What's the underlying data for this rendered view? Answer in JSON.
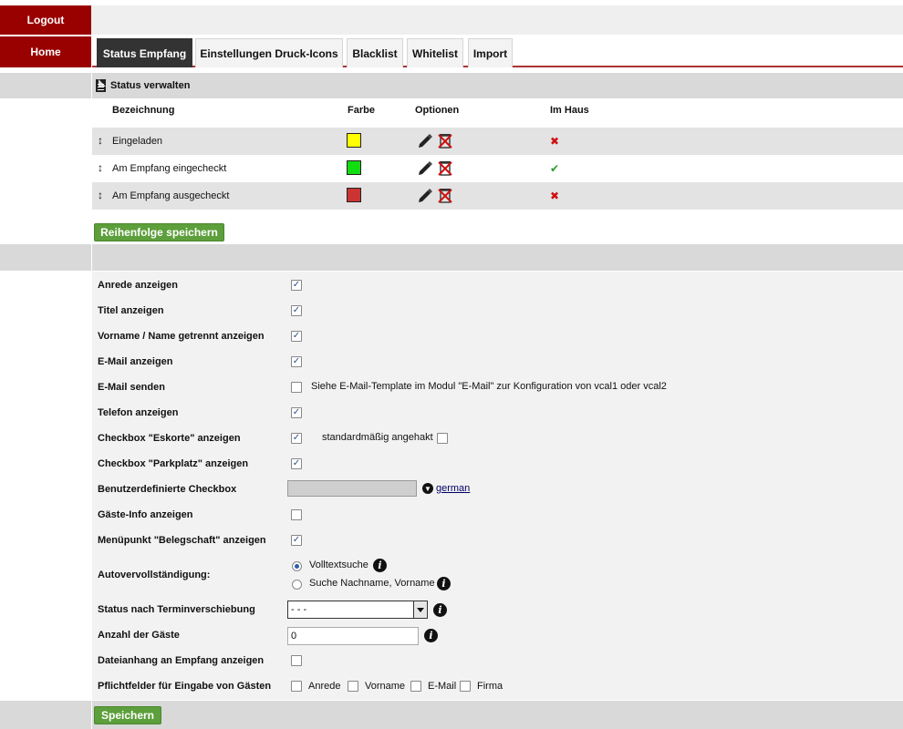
{
  "nav": {
    "logout": "Logout",
    "home": "Home"
  },
  "tabs": [
    {
      "label": "Status Empfang",
      "active": true
    },
    {
      "label": "Einstellungen Druck-Icons"
    },
    {
      "label": "Blacklist"
    },
    {
      "label": "Whitelist"
    },
    {
      "label": "Import"
    }
  ],
  "status_section": {
    "title": "Status verwalten",
    "columns": {
      "name": "Bezeichnung",
      "color": "Farbe",
      "options": "Optionen",
      "in_house": "Im Haus"
    },
    "rows": [
      {
        "name": "Eingeladen",
        "color": "#ffff00",
        "in_house": "✖",
        "in_house_color": "#d01010"
      },
      {
        "name": "Am Empfang eingecheckt",
        "color": "#11dd11",
        "in_house": "✔",
        "in_house_color": "#2a9a2a"
      },
      {
        "name": "Am Empfang ausgecheckt",
        "color": "#cc3333",
        "in_house": "✖",
        "in_house_color": "#d01010"
      }
    ],
    "save_order_label": "Reihenfolge speichern"
  },
  "settings": {
    "anrede": "Anrede anzeigen",
    "titel": "Titel anzeigen",
    "vorname": "Vorname / Name getrennt anzeigen",
    "email_show": "E-Mail anzeigen",
    "email_send": "E-Mail senden",
    "email_send_note": "Siehe E-Mail-Template im Modul \"E-Mail\" zur Konfiguration von vcal1 oder vcal2",
    "telefon": "Telefon anzeigen",
    "eskorte": "Checkbox \"Eskorte\" anzeigen",
    "eskorte_note": "standardmäßig angehakt",
    "parkplatz": "Checkbox \"Parkplatz\" anzeigen",
    "custom_checkbox": "Benutzerdefinierte Checkbox",
    "custom_lang": "german",
    "gaeste_info": "Gäste-Info anzeigen",
    "belegschaft": "Menüpunkt \"Belegschaft\" anzeigen",
    "autocomplete": "Autovervollständigung:",
    "autocomplete_opt1": "Volltextsuche",
    "autocomplete_opt2": "Suche Nachname, Vorname",
    "status_shift": "Status nach Terminverschiebung",
    "status_shift_value": "- - -",
    "guest_count": "Anzahl der Gäste",
    "guest_count_value": "0",
    "attachment": "Dateianhang an Empfang anzeigen",
    "required_fields": "Pflichtfelder für Eingabe von Gästen",
    "req_anrede": "Anrede",
    "req_vorname": "Vorname",
    "req_email": "E-Mail",
    "req_firma": "Firma",
    "save_label": "Speichern"
  },
  "icons": {
    "info": "i",
    "lang": "▼"
  }
}
